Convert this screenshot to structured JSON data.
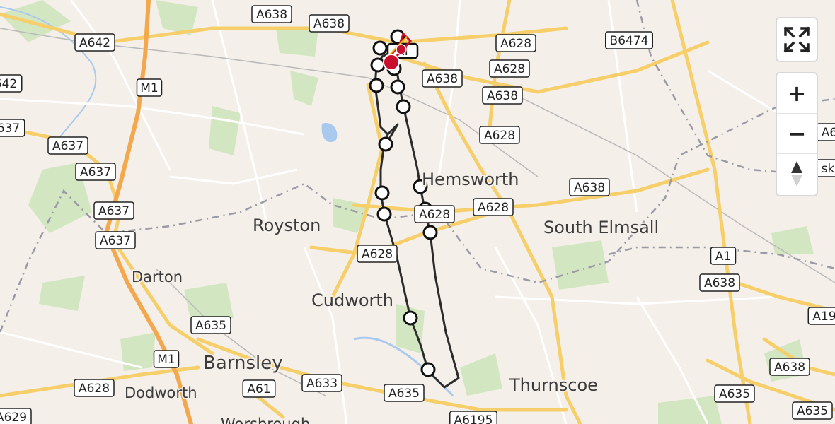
{
  "places": [
    {
      "id": "hemsworth",
      "label": "Hemsworth"
    },
    {
      "id": "royston",
      "label": "Royston"
    },
    {
      "id": "south-elmsall",
      "label": "South Elmsall"
    },
    {
      "id": "darton",
      "label": "Darton"
    },
    {
      "id": "cudworth",
      "label": "Cudworth"
    },
    {
      "id": "barnsley",
      "label": "Barnsley"
    },
    {
      "id": "dodworth",
      "label": "Dodworth"
    },
    {
      "id": "thurnscoe",
      "label": "Thurnscoe"
    },
    {
      "id": "worsbrough",
      "label": "Worsbrough"
    }
  ],
  "road_labels": [
    {
      "id": "a638-top1",
      "label": "A638"
    },
    {
      "id": "a638-top2",
      "label": "A638"
    },
    {
      "id": "a642-top",
      "label": "A642"
    },
    {
      "id": "a642-left",
      "label": "642"
    },
    {
      "id": "m1-top",
      "label": "M1"
    },
    {
      "id": "a628-ne1",
      "label": "A628"
    },
    {
      "id": "a628-ne2",
      "label": "A628"
    },
    {
      "id": "b6474",
      "label": "B6474"
    },
    {
      "id": "a638-mid1",
      "label": "A638"
    },
    {
      "id": "a638-mid2",
      "label": "A638"
    },
    {
      "id": "a628-mid",
      "label": "A628"
    },
    {
      "id": "a637-left",
      "label": "637"
    },
    {
      "id": "a637-1",
      "label": "A637"
    },
    {
      "id": "a637-2",
      "label": "A637"
    },
    {
      "id": "a637-3",
      "label": "A637"
    },
    {
      "id": "a637-4",
      "label": "A637"
    },
    {
      "id": "a638-hem",
      "label": "A638"
    },
    {
      "id": "a628-hem",
      "label": "A628"
    },
    {
      "id": "a628-hem2",
      "label": "A628"
    },
    {
      "id": "a628-cud",
      "label": "A628"
    },
    {
      "id": "a635-left",
      "label": "A635"
    },
    {
      "id": "m1-low",
      "label": "M1"
    },
    {
      "id": "a628-dod",
      "label": "A628"
    },
    {
      "id": "a61",
      "label": "A61"
    },
    {
      "id": "a633",
      "label": "A633"
    },
    {
      "id": "a635-mid",
      "label": "A635"
    },
    {
      "id": "a6195",
      "label": "A6195"
    },
    {
      "id": "a629",
      "label": "A629"
    },
    {
      "id": "a1",
      "label": "A1"
    },
    {
      "id": "a638-se",
      "label": "A638"
    },
    {
      "id": "a638-se2",
      "label": "A638"
    },
    {
      "id": "a635-se",
      "label": "A635"
    },
    {
      "id": "a635-se2",
      "label": "A635"
    },
    {
      "id": "a19",
      "label": "A19"
    },
    {
      "id": "a6-edge",
      "label": "A6"
    },
    {
      "id": "sk-edge",
      "label": "sk"
    }
  ],
  "route": {
    "color": "#2b2b2b",
    "marker_count": 15
  },
  "destination": {
    "color": "#c8102e",
    "label": "RI"
  },
  "controls": {
    "fullscreen_icon": "fullscreen-icon",
    "zoom_in_label": "+",
    "zoom_out_label": "−",
    "compass_icon": "compass-icon"
  }
}
